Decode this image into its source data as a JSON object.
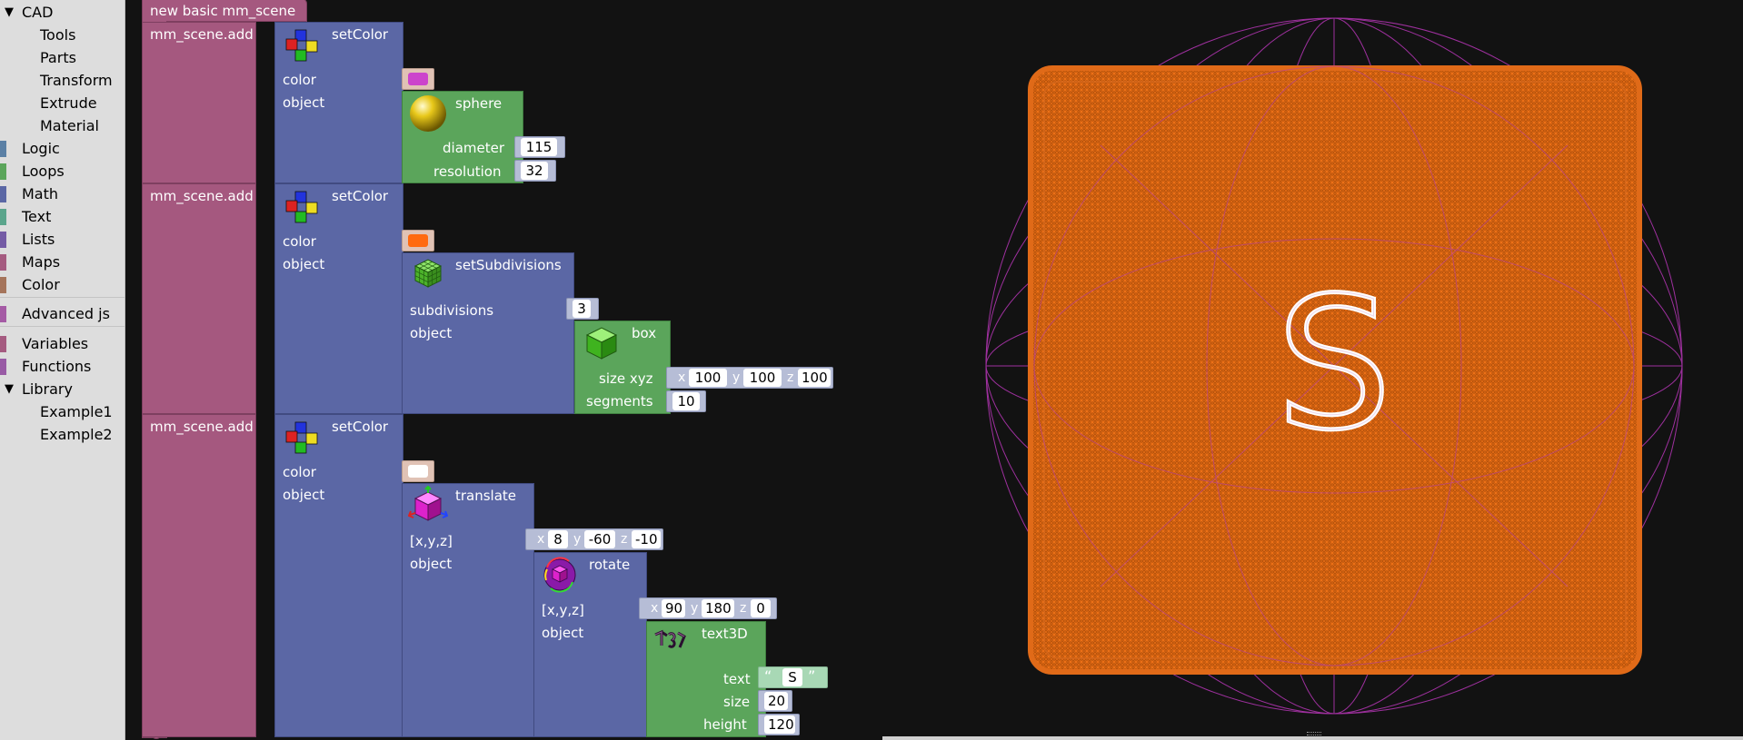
{
  "sidebar": {
    "cad": {
      "label": "CAD",
      "expanded": true,
      "children": [
        "Tools",
        "Parts",
        "Transform",
        "Extrude",
        "Material"
      ]
    },
    "categories": [
      {
        "label": "Logic",
        "color": "#5b80a5"
      },
      {
        "label": "Loops",
        "color": "#5ba55b"
      },
      {
        "label": "Math",
        "color": "#5b67a5"
      },
      {
        "label": "Text",
        "color": "#5ba58c"
      },
      {
        "label": "Lists",
        "color": "#745ba5"
      },
      {
        "label": "Maps",
        "color": "#a55b80"
      },
      {
        "label": "Color",
        "color": "#a5745b"
      }
    ],
    "advanced": {
      "label": "Advanced js",
      "color": "#a55ba5"
    },
    "variables": {
      "label": "Variables",
      "color": "#a55b80"
    },
    "functions": {
      "label": "Functions",
      "color": "#995ba5"
    },
    "library": {
      "label": "Library",
      "expanded": true,
      "children": [
        "Example1",
        "Example2"
      ]
    }
  },
  "workspace": {
    "root": {
      "label": "new basic mm_scene"
    },
    "rows": [
      {
        "add_label": "mm_scene.add",
        "setcolor_label": "setColor",
        "color_label": "color",
        "color_value": "#cc44cc",
        "object_label": "object",
        "sphere": {
          "label": "sphere",
          "diameter_label": "diameter",
          "diameter": "115",
          "resolution_label": "resolution",
          "resolution": "32"
        }
      },
      {
        "add_label": "mm_scene.add",
        "setcolor_label": "setColor",
        "color_label": "color",
        "color_value": "#ff6a10",
        "object_label": "object",
        "subdiv": {
          "label": "setSubdivisions",
          "subdivisions_label": "subdivisions",
          "subdivisions": "3",
          "object_label": "object"
        },
        "box": {
          "label": "box",
          "size_label": "size xyz",
          "x": "100",
          "y": "100",
          "z": "100",
          "segments_label": "segments",
          "segments": "10"
        }
      },
      {
        "add_label": "mm_scene.add",
        "setcolor_label": "setColor",
        "color_label": "color",
        "color_value": "#ffffff",
        "object_label": "object",
        "translate": {
          "label": "translate",
          "xyz_label": "[x,y,z]",
          "x": "8",
          "y": "-60",
          "z": "-10",
          "object_label": "object"
        },
        "rotate": {
          "label": "rotate",
          "xyz_label": "[x,y,z]",
          "x": "90",
          "y": "180",
          "z": "0",
          "object_label": "object"
        },
        "text3d": {
          "label": "text3D",
          "text_label": "text",
          "text": "S",
          "size_label": "size",
          "size": "20",
          "height_label": "height",
          "height": "120"
        }
      }
    ],
    "axis_letters": {
      "x": "x",
      "y": "y",
      "z": "z"
    },
    "quote_open": "“",
    "quote_close": "”"
  },
  "viewport": {
    "letter": "S",
    "box_color": "#e0620f",
    "sphere_color": "#a632a6",
    "text_color": "#ffffff"
  },
  "icons": {
    "toolbox_expanded": "triangle-down-icon",
    "setcolor": "color-cubes-icon",
    "sphere": "sphere-icon",
    "subdivisions": "subdivided-cube-icon",
    "box": "box-icon",
    "translate": "translate-icon",
    "rotate": "rotate-icon",
    "text3d": "text3d-icon"
  }
}
